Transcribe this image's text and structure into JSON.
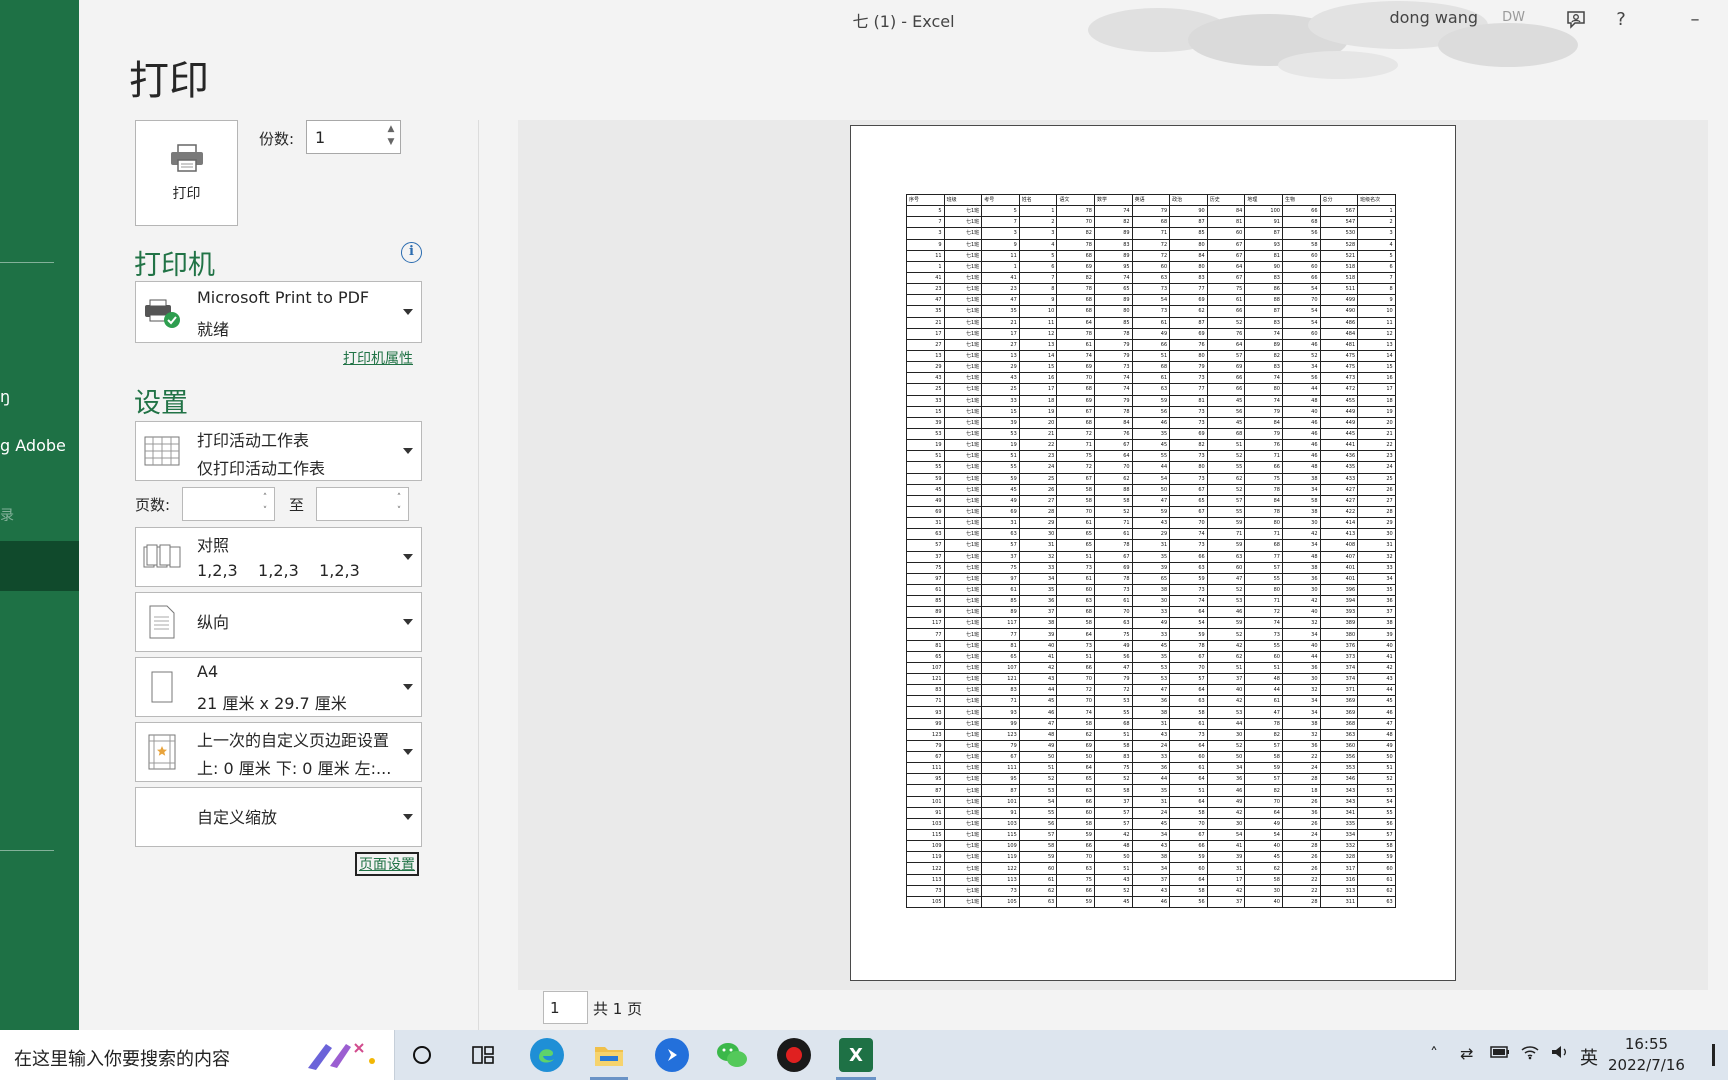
{
  "window": {
    "title": "七 (1)  -  Excel",
    "user_name": "dong wang",
    "user_initials": "DW",
    "help_label": "?",
    "minimize_label": "–"
  },
  "nav": {
    "item_partial_1": "ŋ",
    "item_partial_2": "g Adobe",
    "item_partial_3": "录"
  },
  "page_title": "打印",
  "print_button": {
    "label": "打印"
  },
  "copies": {
    "label": "份数:",
    "value": "1"
  },
  "printer": {
    "heading": "打印机",
    "name": "Microsoft Print to PDF",
    "status": "就绪",
    "properties_link": "打印机属性"
  },
  "settings": {
    "heading": "设置",
    "what": {
      "line1": "打印活动工作表",
      "line2": "仅打印活动工作表"
    },
    "pages_label": "页数:",
    "pages_to": "至",
    "pages_from_value": "",
    "pages_to_value": "",
    "collate": {
      "line1": "对照",
      "line2": "1,2,3    1,2,3    1,2,3"
    },
    "orientation": {
      "line1": "纵向"
    },
    "paper": {
      "line1": "A4",
      "line2": "21 厘米 x 29.7 厘米"
    },
    "margins": {
      "line1": "上一次的自定义页边距设置",
      "line2": "上: 0 厘米 下: 0 厘米 左:..."
    },
    "scaling": {
      "line1": "自定义缩放"
    },
    "page_setup_link": "页面设置"
  },
  "pager": {
    "current": "1",
    "total": "共 1 页"
  },
  "sheet": {
    "headers": [
      "序号",
      "班级",
      "考号",
      "姓名",
      "语文",
      "数学",
      "英语",
      "政治",
      "历史",
      "地理",
      "生物",
      "总分",
      "班级名次"
    ],
    "rows": [
      [
        "5",
        "七1班",
        "5",
        "1",
        "78",
        "74",
        "79",
        "90",
        "84",
        "100",
        "66",
        "567",
        "1"
      ],
      [
        "7",
        "七1班",
        "7",
        "2",
        "70",
        "82",
        "68",
        "87",
        "81",
        "91",
        "68",
        "547",
        "2"
      ],
      [
        "3",
        "七1班",
        "3",
        "3",
        "82",
        "89",
        "71",
        "85",
        "60",
        "87",
        "56",
        "530",
        "3"
      ],
      [
        "9",
        "七1班",
        "9",
        "4",
        "78",
        "83",
        "72",
        "80",
        "67",
        "93",
        "58",
        "528",
        "4"
      ],
      [
        "11",
        "七1班",
        "11",
        "5",
        "68",
        "89",
        "72",
        "84",
        "67",
        "81",
        "60",
        "521",
        "5"
      ],
      [
        "1",
        "七1班",
        "1",
        "6",
        "69",
        "95",
        "60",
        "80",
        "64",
        "90",
        "60",
        "518",
        "6"
      ],
      [
        "41",
        "七1班",
        "41",
        "7",
        "82",
        "74",
        "63",
        "83",
        "67",
        "83",
        "66",
        "518",
        "7"
      ],
      [
        "23",
        "七1班",
        "23",
        "8",
        "78",
        "65",
        "73",
        "77",
        "75",
        "86",
        "54",
        "511",
        "8"
      ],
      [
        "47",
        "七1班",
        "47",
        "9",
        "68",
        "89",
        "54",
        "69",
        "61",
        "88",
        "70",
        "499",
        "9"
      ],
      [
        "35",
        "七1班",
        "35",
        "10",
        "68",
        "80",
        "73",
        "62",
        "66",
        "87",
        "54",
        "490",
        "10"
      ],
      [
        "21",
        "七1班",
        "21",
        "11",
        "64",
        "85",
        "61",
        "87",
        "52",
        "83",
        "54",
        "486",
        "11"
      ],
      [
        "17",
        "七1班",
        "17",
        "12",
        "78",
        "78",
        "49",
        "69",
        "76",
        "74",
        "60",
        "484",
        "12"
      ],
      [
        "27",
        "七1班",
        "27",
        "13",
        "61",
        "79",
        "66",
        "76",
        "64",
        "89",
        "46",
        "481",
        "13"
      ],
      [
        "13",
        "七1班",
        "13",
        "14",
        "74",
        "79",
        "51",
        "80",
        "57",
        "82",
        "52",
        "475",
        "14"
      ],
      [
        "29",
        "七1班",
        "29",
        "15",
        "69",
        "73",
        "68",
        "79",
        "69",
        "83",
        "34",
        "475",
        "15"
      ],
      [
        "43",
        "七1班",
        "43",
        "16",
        "70",
        "74",
        "61",
        "73",
        "66",
        "74",
        "56",
        "473",
        "16"
      ],
      [
        "25",
        "七1班",
        "25",
        "17",
        "68",
        "74",
        "63",
        "77",
        "66",
        "80",
        "44",
        "472",
        "17"
      ],
      [
        "33",
        "七1班",
        "33",
        "18",
        "69",
        "79",
        "59",
        "81",
        "45",
        "74",
        "48",
        "455",
        "18"
      ],
      [
        "15",
        "七1班",
        "15",
        "19",
        "67",
        "78",
        "56",
        "73",
        "56",
        "79",
        "40",
        "449",
        "19"
      ],
      [
        "39",
        "七1班",
        "39",
        "20",
        "68",
        "84",
        "46",
        "73",
        "45",
        "84",
        "46",
        "449",
        "20"
      ],
      [
        "53",
        "七1班",
        "53",
        "21",
        "72",
        "76",
        "35",
        "69",
        "68",
        "79",
        "46",
        "445",
        "21"
      ],
      [
        "19",
        "七1班",
        "19",
        "22",
        "71",
        "67",
        "45",
        "82",
        "51",
        "76",
        "46",
        "441",
        "22"
      ],
      [
        "51",
        "七1班",
        "51",
        "23",
        "75",
        "64",
        "55",
        "73",
        "52",
        "71",
        "46",
        "436",
        "23"
      ],
      [
        "55",
        "七1班",
        "55",
        "24",
        "72",
        "70",
        "44",
        "80",
        "55",
        "66",
        "48",
        "435",
        "24"
      ],
      [
        "59",
        "七1班",
        "59",
        "25",
        "67",
        "62",
        "54",
        "73",
        "62",
        "75",
        "38",
        "433",
        "25"
      ],
      [
        "45",
        "七1班",
        "45",
        "26",
        "58",
        "88",
        "50",
        "67",
        "52",
        "78",
        "34",
        "427",
        "26"
      ],
      [
        "49",
        "七1班",
        "49",
        "27",
        "58",
        "58",
        "47",
        "65",
        "57",
        "84",
        "58",
        "427",
        "27"
      ],
      [
        "69",
        "七1班",
        "69",
        "28",
        "70",
        "52",
        "59",
        "67",
        "55",
        "78",
        "38",
        "422",
        "28"
      ],
      [
        "31",
        "七1班",
        "31",
        "29",
        "61",
        "71",
        "43",
        "70",
        "59",
        "80",
        "30",
        "414",
        "29"
      ],
      [
        "63",
        "七1班",
        "63",
        "30",
        "65",
        "61",
        "29",
        "74",
        "71",
        "71",
        "42",
        "413",
        "30"
      ],
      [
        "57",
        "七1班",
        "57",
        "31",
        "65",
        "78",
        "31",
        "73",
        "59",
        "68",
        "34",
        "408",
        "31"
      ],
      [
        "37",
        "七1班",
        "37",
        "32",
        "51",
        "67",
        "35",
        "66",
        "63",
        "77",
        "48",
        "407",
        "32"
      ],
      [
        "75",
        "七1班",
        "75",
        "33",
        "73",
        "69",
        "39",
        "63",
        "60",
        "57",
        "38",
        "401",
        "33"
      ],
      [
        "97",
        "七1班",
        "97",
        "34",
        "61",
        "78",
        "65",
        "59",
        "47",
        "55",
        "36",
        "401",
        "34"
      ],
      [
        "61",
        "七1班",
        "61",
        "35",
        "60",
        "73",
        "38",
        "73",
        "52",
        "80",
        "30",
        "396",
        "35"
      ],
      [
        "85",
        "七1班",
        "85",
        "36",
        "63",
        "61",
        "30",
        "74",
        "53",
        "71",
        "42",
        "394",
        "36"
      ],
      [
        "89",
        "七1班",
        "89",
        "37",
        "68",
        "70",
        "33",
        "64",
        "46",
        "72",
        "40",
        "393",
        "37"
      ],
      [
        "117",
        "七1班",
        "117",
        "38",
        "58",
        "63",
        "49",
        "54",
        "59",
        "74",
        "32",
        "389",
        "38"
      ],
      [
        "77",
        "七1班",
        "77",
        "39",
        "64",
        "75",
        "33",
        "59",
        "52",
        "73",
        "34",
        "380",
        "39"
      ],
      [
        "81",
        "七1班",
        "81",
        "40",
        "73",
        "49",
        "45",
        "78",
        "42",
        "55",
        "40",
        "376",
        "40"
      ],
      [
        "65",
        "七1班",
        "65",
        "41",
        "51",
        "56",
        "35",
        "67",
        "62",
        "60",
        "44",
        "373",
        "41"
      ],
      [
        "107",
        "七1班",
        "107",
        "42",
        "66",
        "47",
        "53",
        "70",
        "51",
        "51",
        "36",
        "374",
        "42"
      ],
      [
        "121",
        "七1班",
        "121",
        "43",
        "70",
        "79",
        "53",
        "57",
        "37",
        "48",
        "30",
        "374",
        "43"
      ],
      [
        "83",
        "七1班",
        "83",
        "44",
        "72",
        "72",
        "47",
        "64",
        "40",
        "44",
        "32",
        "371",
        "44"
      ],
      [
        "71",
        "七1班",
        "71",
        "45",
        "70",
        "53",
        "36",
        "63",
        "42",
        "61",
        "34",
        "369",
        "45"
      ],
      [
        "93",
        "七1班",
        "93",
        "46",
        "74",
        "55",
        "38",
        "58",
        "53",
        "47",
        "34",
        "369",
        "46"
      ],
      [
        "99",
        "七1班",
        "99",
        "47",
        "58",
        "68",
        "31",
        "61",
        "44",
        "78",
        "38",
        "368",
        "47"
      ],
      [
        "123",
        "七1班",
        "123",
        "48",
        "62",
        "51",
        "43",
        "73",
        "30",
        "82",
        "32",
        "363",
        "48"
      ],
      [
        "79",
        "七1班",
        "79",
        "49",
        "69",
        "58",
        "24",
        "64",
        "52",
        "57",
        "36",
        "360",
        "49"
      ],
      [
        "67",
        "七1班",
        "67",
        "50",
        "50",
        "83",
        "33",
        "60",
        "50",
        "58",
        "22",
        "356",
        "50"
      ],
      [
        "111",
        "七1班",
        "111",
        "51",
        "64",
        "75",
        "36",
        "61",
        "34",
        "59",
        "24",
        "353",
        "51"
      ],
      [
        "95",
        "七1班",
        "95",
        "52",
        "65",
        "52",
        "44",
        "64",
        "36",
        "57",
        "28",
        "346",
        "52"
      ],
      [
        "87",
        "七1班",
        "87",
        "53",
        "63",
        "58",
        "35",
        "51",
        "46",
        "82",
        "18",
        "343",
        "53"
      ],
      [
        "101",
        "七1班",
        "101",
        "54",
        "66",
        "37",
        "31",
        "64",
        "49",
        "70",
        "26",
        "343",
        "54"
      ],
      [
        "91",
        "七1班",
        "91",
        "55",
        "60",
        "57",
        "24",
        "58",
        "42",
        "64",
        "36",
        "341",
        "55"
      ],
      [
        "103",
        "七1班",
        "103",
        "56",
        "58",
        "57",
        "45",
        "70",
        "30",
        "49",
        "26",
        "335",
        "56"
      ],
      [
        "115",
        "七1班",
        "115",
        "57",
        "59",
        "42",
        "34",
        "67",
        "54",
        "54",
        "24",
        "334",
        "57"
      ],
      [
        "109",
        "七1班",
        "109",
        "58",
        "66",
        "48",
        "43",
        "66",
        "41",
        "40",
        "28",
        "332",
        "58"
      ],
      [
        "119",
        "七1班",
        "119",
        "59",
        "70",
        "50",
        "38",
        "59",
        "39",
        "45",
        "26",
        "328",
        "59"
      ],
      [
        "122",
        "七1班",
        "122",
        "60",
        "63",
        "51",
        "34",
        "60",
        "31",
        "62",
        "26",
        "317",
        "60"
      ],
      [
        "113",
        "七1班",
        "113",
        "61",
        "75",
        "43",
        "37",
        "64",
        "17",
        "58",
        "22",
        "316",
        "61"
      ],
      [
        "73",
        "七1班",
        "73",
        "62",
        "66",
        "52",
        "43",
        "58",
        "42",
        "30",
        "22",
        "313",
        "62"
      ],
      [
        "105",
        "七1班",
        "105",
        "63",
        "59",
        "45",
        "46",
        "56",
        "37",
        "40",
        "28",
        "311",
        "63"
      ]
    ]
  },
  "taskbar": {
    "search_placeholder": "在这里输入你要搜索的内容",
    "ime_label": "英",
    "time": "16:55",
    "date": "2022/7/16"
  },
  "colors": {
    "accent": "#217346",
    "nav_bg": "#1e7145",
    "nav_active": "#104a2c"
  }
}
